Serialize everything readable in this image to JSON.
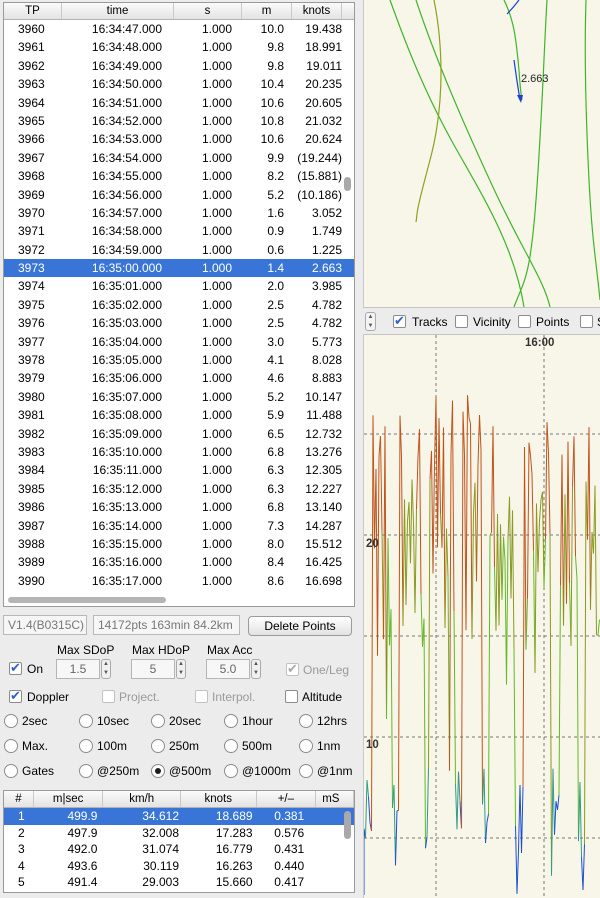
{
  "trackpoints": {
    "columns": [
      "TP",
      "time",
      "s",
      "m",
      "knots"
    ],
    "rows": [
      {
        "tp": "3960",
        "time": "16:34:47.000",
        "s": "1.000",
        "m": "10.0",
        "knots": "19.438"
      },
      {
        "tp": "3961",
        "time": "16:34:48.000",
        "s": "1.000",
        "m": "9.8",
        "knots": "18.991"
      },
      {
        "tp": "3962",
        "time": "16:34:49.000",
        "s": "1.000",
        "m": "9.8",
        "knots": "19.011"
      },
      {
        "tp": "3963",
        "time": "16:34:50.000",
        "s": "1.000",
        "m": "10.4",
        "knots": "20.235"
      },
      {
        "tp": "3964",
        "time": "16:34:51.000",
        "s": "1.000",
        "m": "10.6",
        "knots": "20.605"
      },
      {
        "tp": "3965",
        "time": "16:34:52.000",
        "s": "1.000",
        "m": "10.8",
        "knots": "21.032"
      },
      {
        "tp": "3966",
        "time": "16:34:53.000",
        "s": "1.000",
        "m": "10.6",
        "knots": "20.624"
      },
      {
        "tp": "3967",
        "time": "16:34:54.000",
        "s": "1.000",
        "m": "9.9",
        "knots": "(19.244)"
      },
      {
        "tp": "3968",
        "time": "16:34:55.000",
        "s": "1.000",
        "m": "8.2",
        "knots": "(15.881)"
      },
      {
        "tp": "3969",
        "time": "16:34:56.000",
        "s": "1.000",
        "m": "5.2",
        "knots": "(10.186)"
      },
      {
        "tp": "3970",
        "time": "16:34:57.000",
        "s": "1.000",
        "m": "1.6",
        "knots": "3.052"
      },
      {
        "tp": "3971",
        "time": "16:34:58.000",
        "s": "1.000",
        "m": "0.9",
        "knots": "1.749"
      },
      {
        "tp": "3972",
        "time": "16:34:59.000",
        "s": "1.000",
        "m": "0.6",
        "knots": "1.225"
      },
      {
        "tp": "3973",
        "time": "16:35:00.000",
        "s": "1.000",
        "m": "1.4",
        "knots": "2.663",
        "selected": true
      },
      {
        "tp": "3974",
        "time": "16:35:01.000",
        "s": "1.000",
        "m": "2.0",
        "knots": "3.985"
      },
      {
        "tp": "3975",
        "time": "16:35:02.000",
        "s": "1.000",
        "m": "2.5",
        "knots": "4.782"
      },
      {
        "tp": "3976",
        "time": "16:35:03.000",
        "s": "1.000",
        "m": "2.5",
        "knots": "4.782"
      },
      {
        "tp": "3977",
        "time": "16:35:04.000",
        "s": "1.000",
        "m": "3.0",
        "knots": "5.773"
      },
      {
        "tp": "3978",
        "time": "16:35:05.000",
        "s": "1.000",
        "m": "4.1",
        "knots": "8.028"
      },
      {
        "tp": "3979",
        "time": "16:35:06.000",
        "s": "1.000",
        "m": "4.6",
        "knots": "8.883"
      },
      {
        "tp": "3980",
        "time": "16:35:07.000",
        "s": "1.000",
        "m": "5.2",
        "knots": "10.147"
      },
      {
        "tp": "3981",
        "time": "16:35:08.000",
        "s": "1.000",
        "m": "5.9",
        "knots": "11.488"
      },
      {
        "tp": "3982",
        "time": "16:35:09.000",
        "s": "1.000",
        "m": "6.5",
        "knots": "12.732"
      },
      {
        "tp": "3983",
        "time": "16:35:10.000",
        "s": "1.000",
        "m": "6.8",
        "knots": "13.276"
      },
      {
        "tp": "3984",
        "time": "16:35:11.000",
        "s": "1.000",
        "m": "6.3",
        "knots": "12.305"
      },
      {
        "tp": "3985",
        "time": "16:35:12.000",
        "s": "1.000",
        "m": "6.3",
        "knots": "12.227"
      },
      {
        "tp": "3986",
        "time": "16:35:13.000",
        "s": "1.000",
        "m": "6.8",
        "knots": "13.140"
      },
      {
        "tp": "3987",
        "time": "16:35:14.000",
        "s": "1.000",
        "m": "7.3",
        "knots": "14.287"
      },
      {
        "tp": "3988",
        "time": "16:35:15.000",
        "s": "1.000",
        "m": "8.0",
        "knots": "15.512"
      },
      {
        "tp": "3989",
        "time": "16:35:16.000",
        "s": "1.000",
        "m": "8.4",
        "knots": "16.425"
      },
      {
        "tp": "3990",
        "time": "16:35:17.000",
        "s": "1.000",
        "m": "8.6",
        "knots": "16.698"
      }
    ]
  },
  "status": {
    "version": "V1.4(B0315C)",
    "summary": "14172pts 163min 84.2km",
    "delete_button": "Delete Points"
  },
  "filter": {
    "on_label": "On",
    "on_checked": true,
    "max_sdop_label": "Max SDoP",
    "max_sdop_value": "1.5",
    "max_hdop_label": "Max HDoP",
    "max_hdop_value": "5",
    "max_acc_label": "Max Acc",
    "max_acc_value": "5.0",
    "one_leg_label": "One/Leg",
    "one_leg_checked": true,
    "doppler_label": "Doppler",
    "doppler_checked": true,
    "project_label": "Project.",
    "interpol_label": "Interpol.",
    "altitude_label": "Altitude"
  },
  "options": {
    "row1": [
      "2sec",
      "10sec",
      "20sec",
      "1hour",
      "12hrs"
    ],
    "row2": [
      "Max.",
      "100m",
      "250m",
      "500m",
      "1nm"
    ],
    "row3": [
      "Gates",
      "@250m",
      "@500m",
      "@1000m",
      "@1nm"
    ],
    "selected": "@500m"
  },
  "gates": {
    "columns": [
      "#",
      "m|sec",
      "km/h",
      "knots",
      "+/–",
      "mS"
    ],
    "rows": [
      {
        "n": "1",
        "msec": "499.9",
        "kmh": "34.612",
        "knots": "18.689",
        "pm": "0.381",
        "selected": true
      },
      {
        "n": "2",
        "msec": "497.9",
        "kmh": "32.008",
        "knots": "17.283",
        "pm": "0.576"
      },
      {
        "n": "3",
        "msec": "492.0",
        "kmh": "31.074",
        "knots": "16.779",
        "pm": "0.431"
      },
      {
        "n": "4",
        "msec": "493.6",
        "kmh": "30.119",
        "knots": "16.263",
        "pm": "0.440"
      },
      {
        "n": "5",
        "msec": "491.4",
        "kmh": "29.003",
        "knots": "15.660",
        "pm": "0.417"
      }
    ]
  },
  "map": {
    "point_label": "2.663",
    "colors": {
      "track_green": "#3fb52a",
      "track_olive": "#8aa31e",
      "track_blue": "#1d3fd4"
    }
  },
  "layer_toggles": {
    "tracks_label": "Tracks",
    "tracks_checked": true,
    "vicinity_label": "Vicinity",
    "vicinity_checked": false,
    "points_label": "Points",
    "points_checked": false,
    "s_label": "S"
  },
  "graph": {
    "time_label": "16:00",
    "y_labels": [
      "20",
      "10"
    ],
    "colors": {
      "fast": "#c0531d",
      "mid": "#64b82a",
      "slow": "#1e4fd0",
      "grid": "#7a7a7a"
    }
  }
}
